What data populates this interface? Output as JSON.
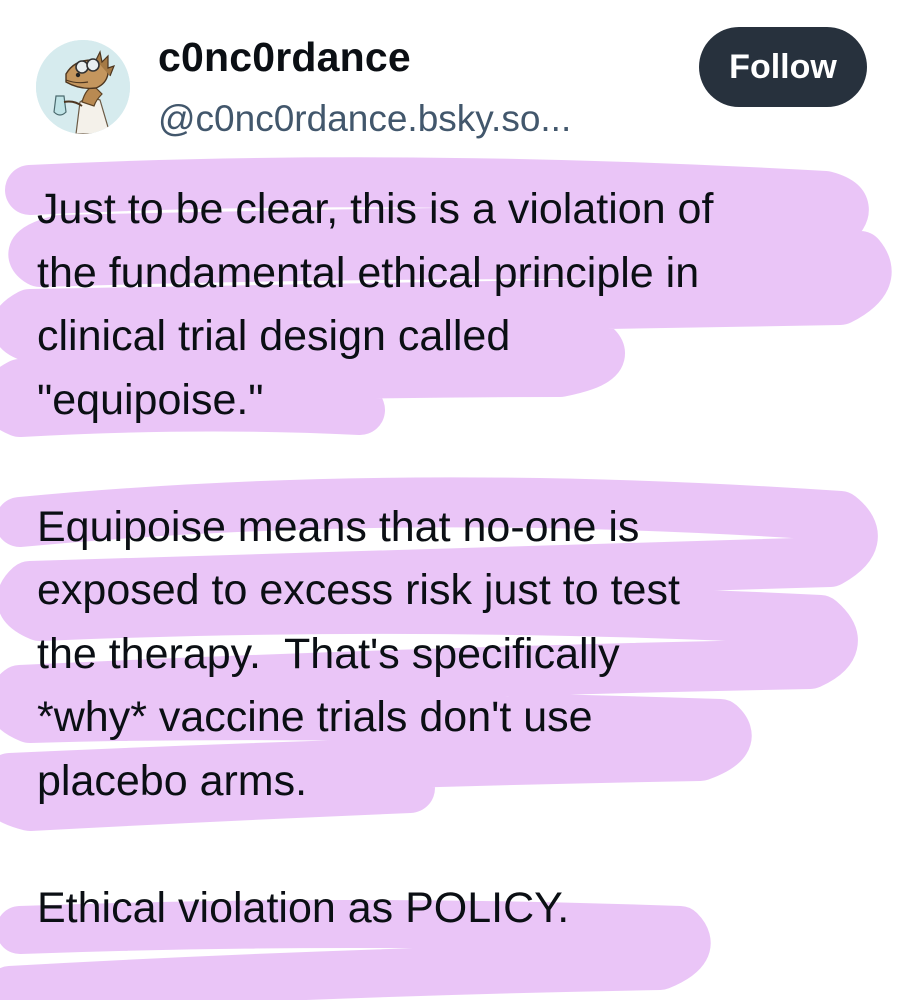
{
  "post": {
    "author": {
      "display_name": "c0nc0rdance",
      "handle": "@c0nc0rdance.bsky.so..."
    },
    "follow_label": "Follow",
    "paragraphs": [
      [
        "Just to be clear, this is a violation of",
        "the fundamental ethical principle in",
        "clinical trial design called",
        "\"equipoise.\""
      ],
      [
        "Equipoise means that no-one is",
        "exposed to excess risk just to test",
        "the therapy.  That's specifically",
        "*why* vaccine trials don't use",
        "placebo arms."
      ],
      [
        "Ethical violation as POLICY."
      ]
    ]
  },
  "highlight_color": "#e9c2f7",
  "avatar_icon": "lizard-scientist-avatar"
}
